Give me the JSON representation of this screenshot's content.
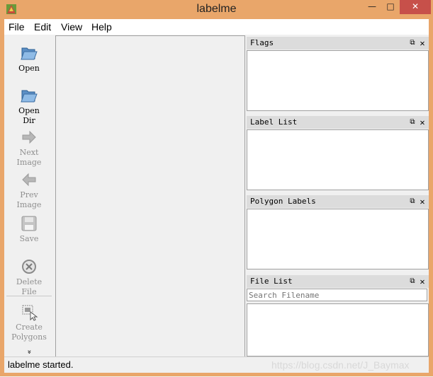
{
  "window": {
    "title": "labelme",
    "min_icon": "minimize-icon",
    "max_icon": "maximize-icon",
    "close_icon": "close-icon"
  },
  "menu": [
    "File",
    "Edit",
    "View",
    "Help"
  ],
  "toolbar": {
    "open": {
      "label_lines": [
        "Open"
      ],
      "icon": "folder-open-icon",
      "enabled": true
    },
    "open_dir": {
      "label_lines": [
        "Open",
        "Dir"
      ],
      "icon": "folder-open-icon",
      "enabled": true
    },
    "next_image": {
      "label_lines": [
        "Next",
        "Image"
      ],
      "icon": "arrow-right-icon",
      "enabled": false
    },
    "prev_image": {
      "label_lines": [
        "Prev",
        "Image"
      ],
      "icon": "arrow-left-icon",
      "enabled": false
    },
    "save": {
      "label_lines": [
        "Save"
      ],
      "icon": "floppy-disk-icon",
      "enabled": false
    },
    "delete_file": {
      "label_lines": [
        "Delete",
        "File"
      ],
      "icon": "delete-circle-icon",
      "enabled": false
    },
    "create_polygons": {
      "label_lines": [
        "Create",
        "Polygons"
      ],
      "icon": "polygon-cursor-icon",
      "enabled": false
    },
    "more_glyph": "»"
  },
  "docks": {
    "flags": {
      "title": "Flags"
    },
    "label_list": {
      "title": "Label List"
    },
    "polygon_labels": {
      "title": "Polygon Labels"
    },
    "file_list": {
      "title": "File List",
      "search_placeholder": "Search Filename"
    },
    "float_glyph": "⧉",
    "close_glyph": "✕"
  },
  "status": {
    "text": "labelme started.",
    "watermark": "https://blog.csdn.net/J_Baymax"
  },
  "colors": {
    "title_bar": "#e9a66a",
    "close_button": "#c7504a",
    "disabled_text": "#8f8f8f"
  }
}
